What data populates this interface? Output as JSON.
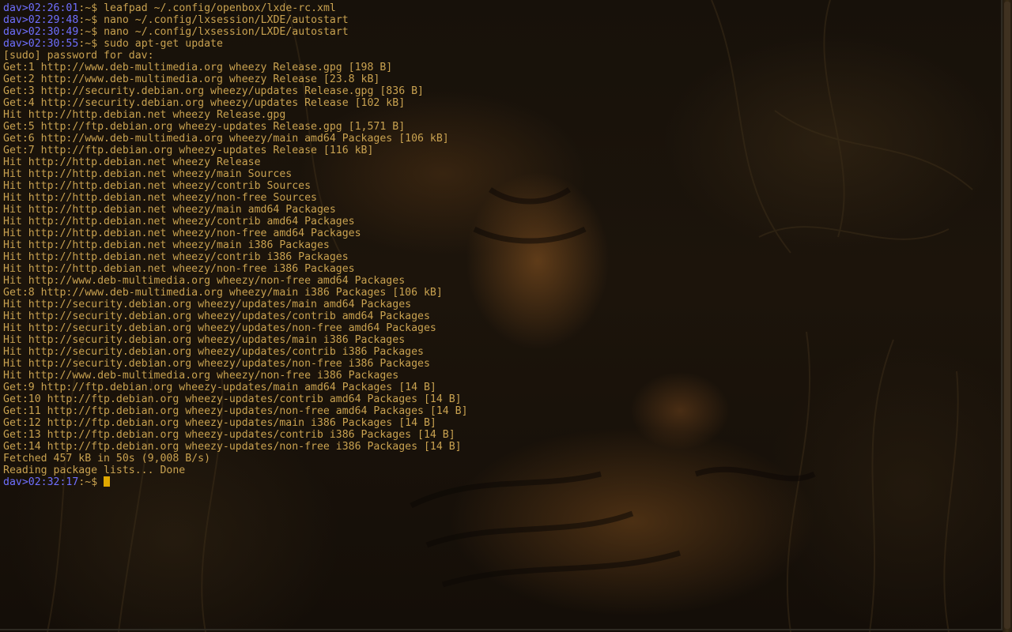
{
  "terminal": {
    "history": [
      {
        "user": "dav",
        "time": "02:26:01",
        "path": ":~$ ",
        "command": "leafpad ~/.config/openbox/lxde-rc.xml"
      },
      {
        "user": "dav",
        "time": "02:29:48",
        "path": ":~$ ",
        "command": "nano ~/.config/lxsession/LXDE/autostart"
      },
      {
        "user": "dav",
        "time": "02:30:49",
        "path": ":~$ ",
        "command": "nano ~/.config/lxsession/LXDE/autostart"
      },
      {
        "user": "dav",
        "time": "02:30:55",
        "path": ":~$ ",
        "command": "sudo apt-get update"
      }
    ],
    "output": [
      "[sudo] password for dav:",
      "Get:1 http://www.deb-multimedia.org wheezy Release.gpg [198 B]",
      "Get:2 http://www.deb-multimedia.org wheezy Release [23.8 kB]",
      "Get:3 http://security.debian.org wheezy/updates Release.gpg [836 B]",
      "Get:4 http://security.debian.org wheezy/updates Release [102 kB]",
      "Hit http://http.debian.net wheezy Release.gpg",
      "Get:5 http://ftp.debian.org wheezy-updates Release.gpg [1,571 B]",
      "Get:6 http://www.deb-multimedia.org wheezy/main amd64 Packages [106 kB]",
      "Get:7 http://ftp.debian.org wheezy-updates Release [116 kB]",
      "Hit http://http.debian.net wheezy Release",
      "Hit http://http.debian.net wheezy/main Sources",
      "Hit http://http.debian.net wheezy/contrib Sources",
      "Hit http://http.debian.net wheezy/non-free Sources",
      "Hit http://http.debian.net wheezy/main amd64 Packages",
      "Hit http://http.debian.net wheezy/contrib amd64 Packages",
      "Hit http://http.debian.net wheezy/non-free amd64 Packages",
      "Hit http://http.debian.net wheezy/main i386 Packages",
      "Hit http://http.debian.net wheezy/contrib i386 Packages",
      "Hit http://http.debian.net wheezy/non-free i386 Packages",
      "Hit http://www.deb-multimedia.org wheezy/non-free amd64 Packages",
      "Get:8 http://www.deb-multimedia.org wheezy/main i386 Packages [106 kB]",
      "Hit http://security.debian.org wheezy/updates/main amd64 Packages",
      "Hit http://security.debian.org wheezy/updates/contrib amd64 Packages",
      "Hit http://security.debian.org wheezy/updates/non-free amd64 Packages",
      "Hit http://security.debian.org wheezy/updates/main i386 Packages",
      "Hit http://security.debian.org wheezy/updates/contrib i386 Packages",
      "Hit http://security.debian.org wheezy/updates/non-free i386 Packages",
      "Hit http://www.deb-multimedia.org wheezy/non-free i386 Packages",
      "Get:9 http://ftp.debian.org wheezy-updates/main amd64 Packages [14 B]",
      "Get:10 http://ftp.debian.org wheezy-updates/contrib amd64 Packages [14 B]",
      "Get:11 http://ftp.debian.org wheezy-updates/non-free amd64 Packages [14 B]",
      "Get:12 http://ftp.debian.org wheezy-updates/main i386 Packages [14 B]",
      "Get:13 http://ftp.debian.org wheezy-updates/contrib i386 Packages [14 B]",
      "Get:14 http://ftp.debian.org wheezy-updates/non-free i386 Packages [14 B]",
      "Fetched 457 kB in 50s (9,008 B/s)",
      "Reading package lists... Done"
    ],
    "current_prompt": {
      "user": "dav",
      "time": "02:32:17",
      "path": ":~$ "
    },
    "colors": {
      "text": "#c9a250",
      "prompt_user_time": "#6f6fff",
      "cursor": "#e0a800",
      "background": "#17110a"
    }
  }
}
